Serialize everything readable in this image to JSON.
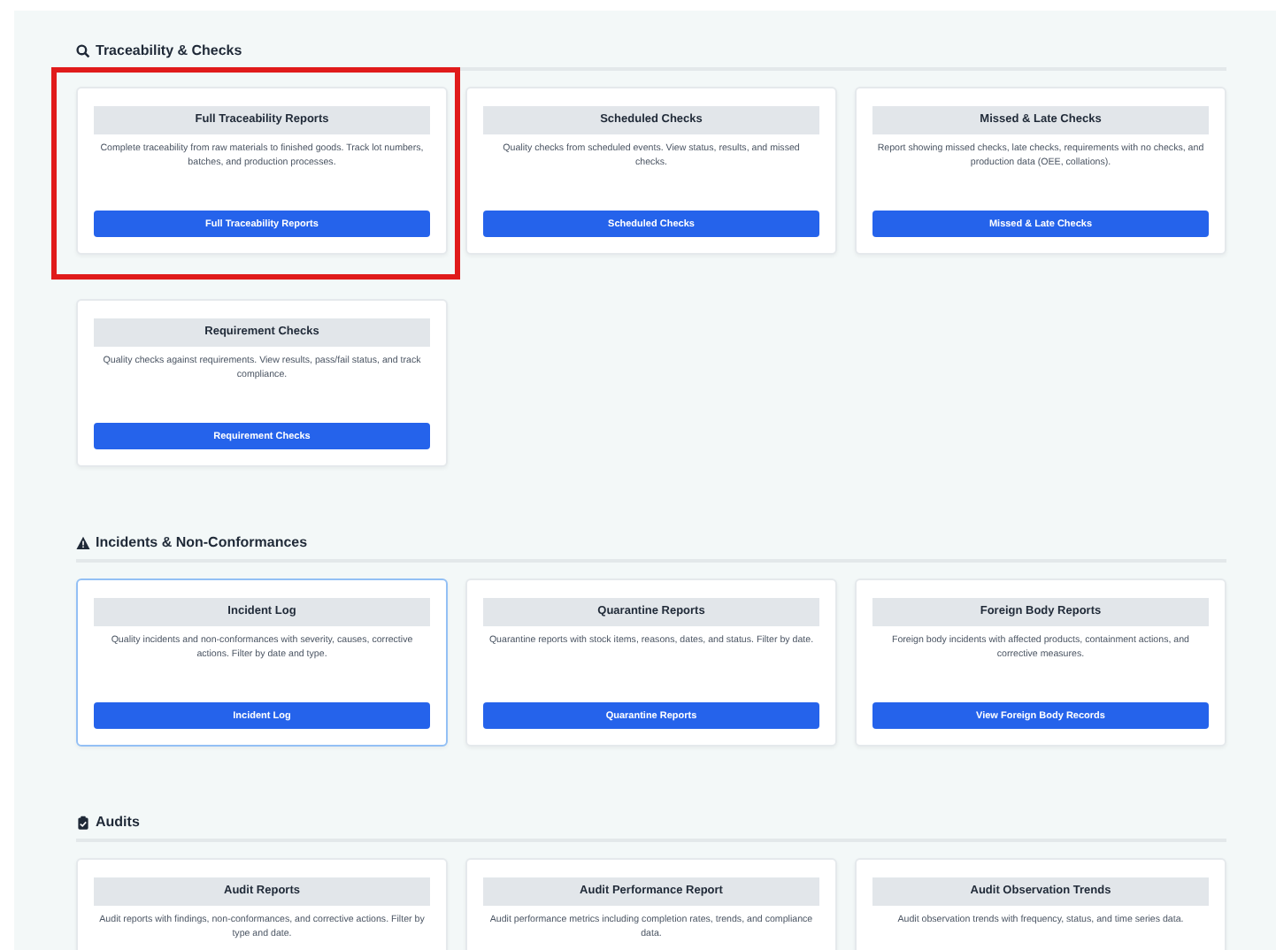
{
  "sections": [
    {
      "title": "Traceability & Checks",
      "kind": "search",
      "cards": [
        {
          "title": "Full Traceability Reports",
          "description": "Complete traceability from raw materials to finished goods. Track lot numbers, batches, and production processes.",
          "button": "Full Traceability Reports",
          "highlighted": true,
          "focused": false
        },
        {
          "title": "Scheduled Checks",
          "description": "Quality checks from scheduled events. View status, results, and missed checks.",
          "button": "Scheduled Checks",
          "highlighted": false,
          "focused": false
        },
        {
          "title": "Missed & Late Checks",
          "description": "Report showing missed checks, late checks, requirements with no checks, and production data (OEE, collations).",
          "button": "Missed & Late Checks",
          "highlighted": false,
          "focused": false
        },
        {
          "title": "Requirement Checks",
          "description": "Quality checks against requirements. View results, pass/fail status, and track compliance.",
          "button": "Requirement Checks",
          "highlighted": false,
          "focused": false
        }
      ]
    },
    {
      "title": "Incidents & Non-Conformances",
      "kind": "warning",
      "cards": [
        {
          "title": "Incident Log",
          "description": "Quality incidents and non-conformances with severity, causes, corrective actions. Filter by date and type.",
          "button": "Incident Log",
          "highlighted": false,
          "focused": true
        },
        {
          "title": "Quarantine Reports",
          "description": "Quarantine reports with stock items, reasons, dates, and status. Filter by date.",
          "button": "Quarantine Reports",
          "highlighted": false,
          "focused": false
        },
        {
          "title": "Foreign Body Reports",
          "description": "Foreign body incidents with affected products, containment actions, and corrective measures.",
          "button": "View Foreign Body Records",
          "highlighted": false,
          "focused": false
        }
      ]
    },
    {
      "title": "Audits",
      "kind": "clipboard",
      "cards": [
        {
          "title": "Audit Reports",
          "description": "Audit reports with findings, non-conformances, and corrective actions. Filter by type and date.",
          "highlighted": false,
          "focused": false
        },
        {
          "title": "Audit Performance Report",
          "description": "Audit performance metrics including completion rates, trends, and compliance data.",
          "highlighted": false,
          "focused": false
        },
        {
          "title": "Audit Observation Trends",
          "description": "Audit observation trends with frequency, status, and time series data.",
          "highlighted": false,
          "focused": false
        }
      ]
    }
  ]
}
